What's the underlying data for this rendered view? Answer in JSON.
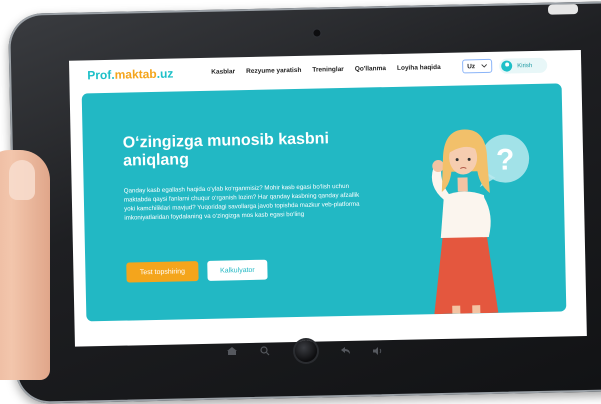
{
  "brand": {
    "logo_part1": "Prof.",
    "logo_part2": "maktab",
    "logo_part3": ".uz"
  },
  "nav": {
    "items": [
      "Kasblar",
      "Rezyume yaratish",
      "Treninglar",
      "Qo'llanma",
      "Loyiha haqida"
    ],
    "language": "Uz",
    "login_label": "Kirish"
  },
  "hero": {
    "title": "O‘zingizga munosib kasbni aniqlang",
    "description": "Qanday kasb egallash haqida o‘ylab ko‘rganmisiz? Mohir kasb egasi bo‘lish uchun maktabda qaysi fanlarni chuqur o‘rganish lozim? Har qanday kasbning qanday afzallik yoki kamchiliklari mavjud? Yuqoridagi savollarga javob topishda mazkur veb-platforma imkoniyatlaridan foydalaning va o‘zingizga mos kasb egasi bo‘ling",
    "primary_button": "Test topshiring",
    "secondary_button": "Kalkulyator",
    "bubble_symbol": "?"
  },
  "colors": {
    "accent": "#22b8c4",
    "logo_teal": "#1ec0c8",
    "orange": "#f4a51c",
    "frame": "#1e1f22"
  },
  "icons": [
    "home-icon",
    "search-icon",
    "back-icon",
    "volume-icon",
    "chevron-down-icon",
    "user-icon"
  ]
}
